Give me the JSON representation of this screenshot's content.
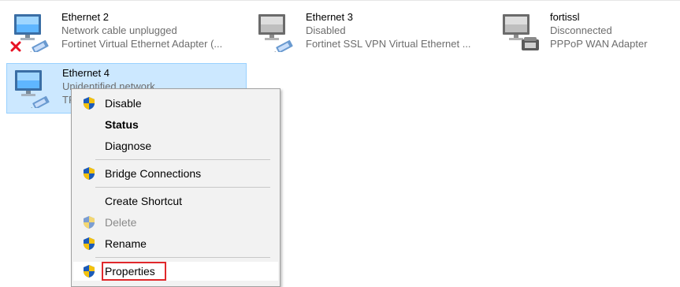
{
  "adapters": [
    {
      "name": "Ethernet 2",
      "status": "Network cable unplugged",
      "device": "Fortinet Virtual Ethernet Adapter (..."
    },
    {
      "name": "Ethernet 3",
      "status": "Disabled",
      "device": "Fortinet SSL VPN Virtual Ethernet ..."
    },
    {
      "name": "fortissl",
      "status": "Disconnected",
      "device": "PPPoP WAN Adapter"
    },
    {
      "name": "Ethernet 4",
      "status": "Unidentified network",
      "device": "TP"
    }
  ],
  "context_menu": {
    "items": [
      {
        "label": "Disable",
        "icon": "uac-shield-icon"
      },
      {
        "label": "Status"
      },
      {
        "label": "Diagnose"
      },
      {
        "label": "Bridge Connections",
        "icon": "uac-shield-icon"
      },
      {
        "label": "Create Shortcut"
      },
      {
        "label": "Delete",
        "icon": "uac-shield-icon"
      },
      {
        "label": "Rename",
        "icon": "uac-shield-icon"
      },
      {
        "label": "Properties",
        "icon": "uac-shield-icon"
      }
    ]
  },
  "colors": {
    "selection": "#cce8ff",
    "selection_border": "#99d1ff",
    "highlight_box": "#e0282b",
    "menu_bg": "#f2f2f2"
  }
}
